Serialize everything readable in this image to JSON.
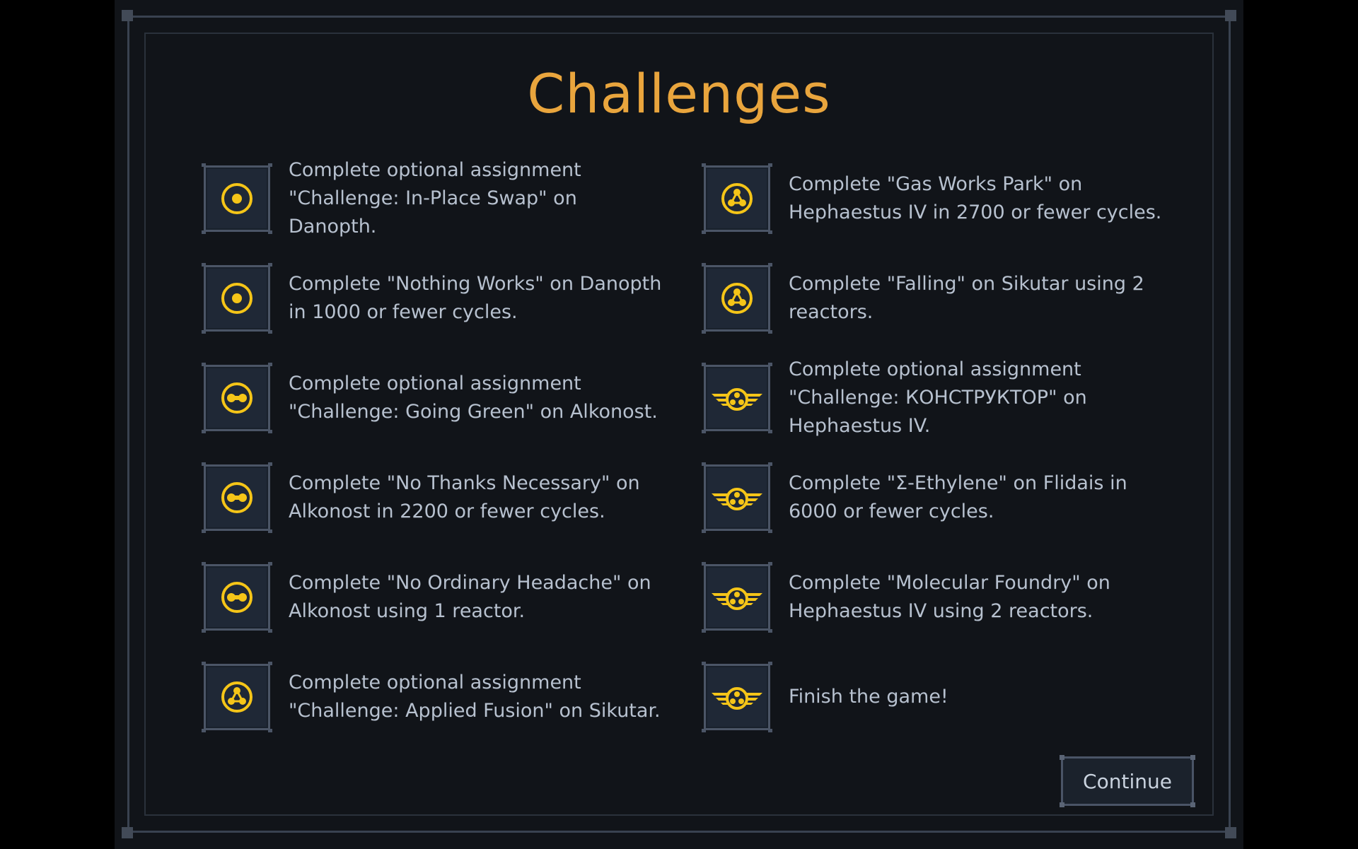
{
  "title": "Challenges",
  "colors": {
    "accent": "#e9a53d",
    "badge_icon": "#f5c518",
    "text": "#b7c1cf",
    "background": "#111419"
  },
  "challenges_left": [
    {
      "icon": "dot-circle-icon",
      "text": "Complete optional assignment \"Challenge: In-Place Swap\" on Danopth."
    },
    {
      "icon": "dot-circle-icon",
      "text": "Complete \"Nothing Works\" on Danopth in 1000 or fewer cycles."
    },
    {
      "icon": "double-dot-circle-icon",
      "text": "Complete optional assignment \"Challenge: Going Green\" on Alkonost."
    },
    {
      "icon": "double-dot-circle-icon",
      "text": "Complete \"No Thanks Necessary\" on Alkonost in 2200 or fewer cycles."
    },
    {
      "icon": "double-dot-circle-icon",
      "text": "Complete \"No Ordinary Headache\" on Alkonost using 1 reactor."
    },
    {
      "icon": "tri-dot-circle-icon",
      "text": "Complete optional assignment \"Challenge: Applied Fusion\" on Sikutar."
    }
  ],
  "challenges_right": [
    {
      "icon": "tri-dot-circle-icon",
      "text": "Complete \"Gas Works Park\" on Hephaestus IV in 2700 or fewer cycles."
    },
    {
      "icon": "tri-dot-circle-icon",
      "text": "Complete \"Falling\" on Sikutar using 2 reactors."
    },
    {
      "icon": "winged-tri-dot-icon",
      "text": "Complete optional assignment \"Challenge: КОНСТРУКТОР\" on Hephaestus IV."
    },
    {
      "icon": "winged-tri-dot-icon",
      "text": "Complete \"Σ-Ethylene\" on Flidais in 6000 or fewer cycles."
    },
    {
      "icon": "winged-tri-dot-icon",
      "text": "Complete \"Molecular Foundry\" on Hephaestus IV using 2 reactors."
    },
    {
      "icon": "winged-tri-dot-icon",
      "text": "Finish the game!"
    }
  ],
  "continue_label": "Continue"
}
